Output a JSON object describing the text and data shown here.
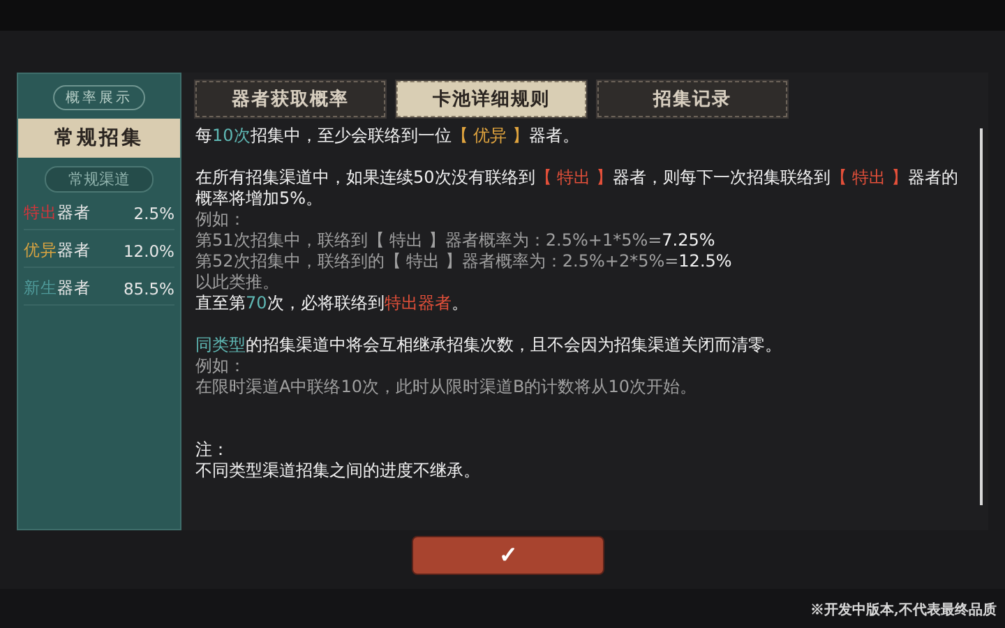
{
  "sidebar": {
    "badge": "概率展示",
    "title": "常规招集",
    "channel": "常规渠道",
    "rows": [
      {
        "tier": "特出",
        "color": "#d8343a",
        "label": "器者",
        "rate": "2.5%"
      },
      {
        "tier": "优异",
        "color": "#d9a441",
        "label": "器者",
        "rate": "12.0%"
      },
      {
        "tier": "新生",
        "color": "#4f9a9a",
        "label": "器者",
        "rate": "85.5%"
      }
    ]
  },
  "tabs": [
    {
      "label": "器者获取概率",
      "selected": false
    },
    {
      "label": "卡池详细规则",
      "selected": true
    },
    {
      "label": "招集记录",
      "selected": false
    }
  ],
  "rules": [
    {
      "kind": "main",
      "parts": [
        {
          "text": "每"
        },
        {
          "text": "10次",
          "color": "#5fb8b4"
        },
        {
          "text": "招集中，至少会联络到一位"
        },
        {
          "text": "【 优异 】",
          "color": "#e0a43e"
        },
        {
          "text": "器者。"
        }
      ]
    },
    {
      "kind": "gap"
    },
    {
      "kind": "main",
      "parts": [
        {
          "text": "在所有招集渠道中，如果连续50次没有联络到"
        },
        {
          "text": "【 特出 】",
          "color": "#e4503a"
        },
        {
          "text": "器者，则每下一次招集联络到"
        },
        {
          "text": "【 特出 】",
          "color": "#e4503a"
        },
        {
          "text": "器者的概率将增加5%。"
        }
      ]
    },
    {
      "kind": "example",
      "parts": [
        {
          "text": "例如："
        }
      ]
    },
    {
      "kind": "example",
      "parts": [
        {
          "text": "第51次招集中，联络到【 特出 】器者概率为：2.5%+1*5%="
        },
        {
          "text": "7.25%",
          "color": "#f2f2f2"
        }
      ]
    },
    {
      "kind": "example",
      "parts": [
        {
          "text": "第52次招集中，联络到的【 特出 】器者概率为：2.5%+2*5%="
        },
        {
          "text": "12.5%",
          "color": "#f2f2f2"
        }
      ]
    },
    {
      "kind": "example",
      "parts": [
        {
          "text": "以此类推。"
        }
      ]
    },
    {
      "kind": "main",
      "parts": [
        {
          "text": "直至第"
        },
        {
          "text": "70",
          "color": "#5fb8b4"
        },
        {
          "text": "次，必将联络到"
        },
        {
          "text": "特出器者",
          "color": "#e4503a"
        },
        {
          "text": "。"
        }
      ]
    },
    {
      "kind": "gap"
    },
    {
      "kind": "main",
      "parts": [
        {
          "text": "同类型",
          "color": "#5fb8b4"
        },
        {
          "text": "的招集渠道中将会互相继承招集次数，且不会因为招集渠道关闭而清零。"
        }
      ]
    },
    {
      "kind": "example",
      "parts": [
        {
          "text": "例如："
        }
      ]
    },
    {
      "kind": "example",
      "parts": [
        {
          "text": "在限时渠道A中联络10次，此时从限时渠道B的计数将从10次开始。"
        }
      ]
    },
    {
      "kind": "gap"
    },
    {
      "kind": "gap"
    },
    {
      "kind": "main",
      "parts": [
        {
          "text": "注："
        }
      ]
    },
    {
      "kind": "main",
      "parts": [
        {
          "text": "不同类型渠道招集之间的进度不继承。"
        }
      ]
    }
  ],
  "confirm": {
    "label": "✓"
  },
  "footnote": "※开发中版本,不代表最终品质"
}
